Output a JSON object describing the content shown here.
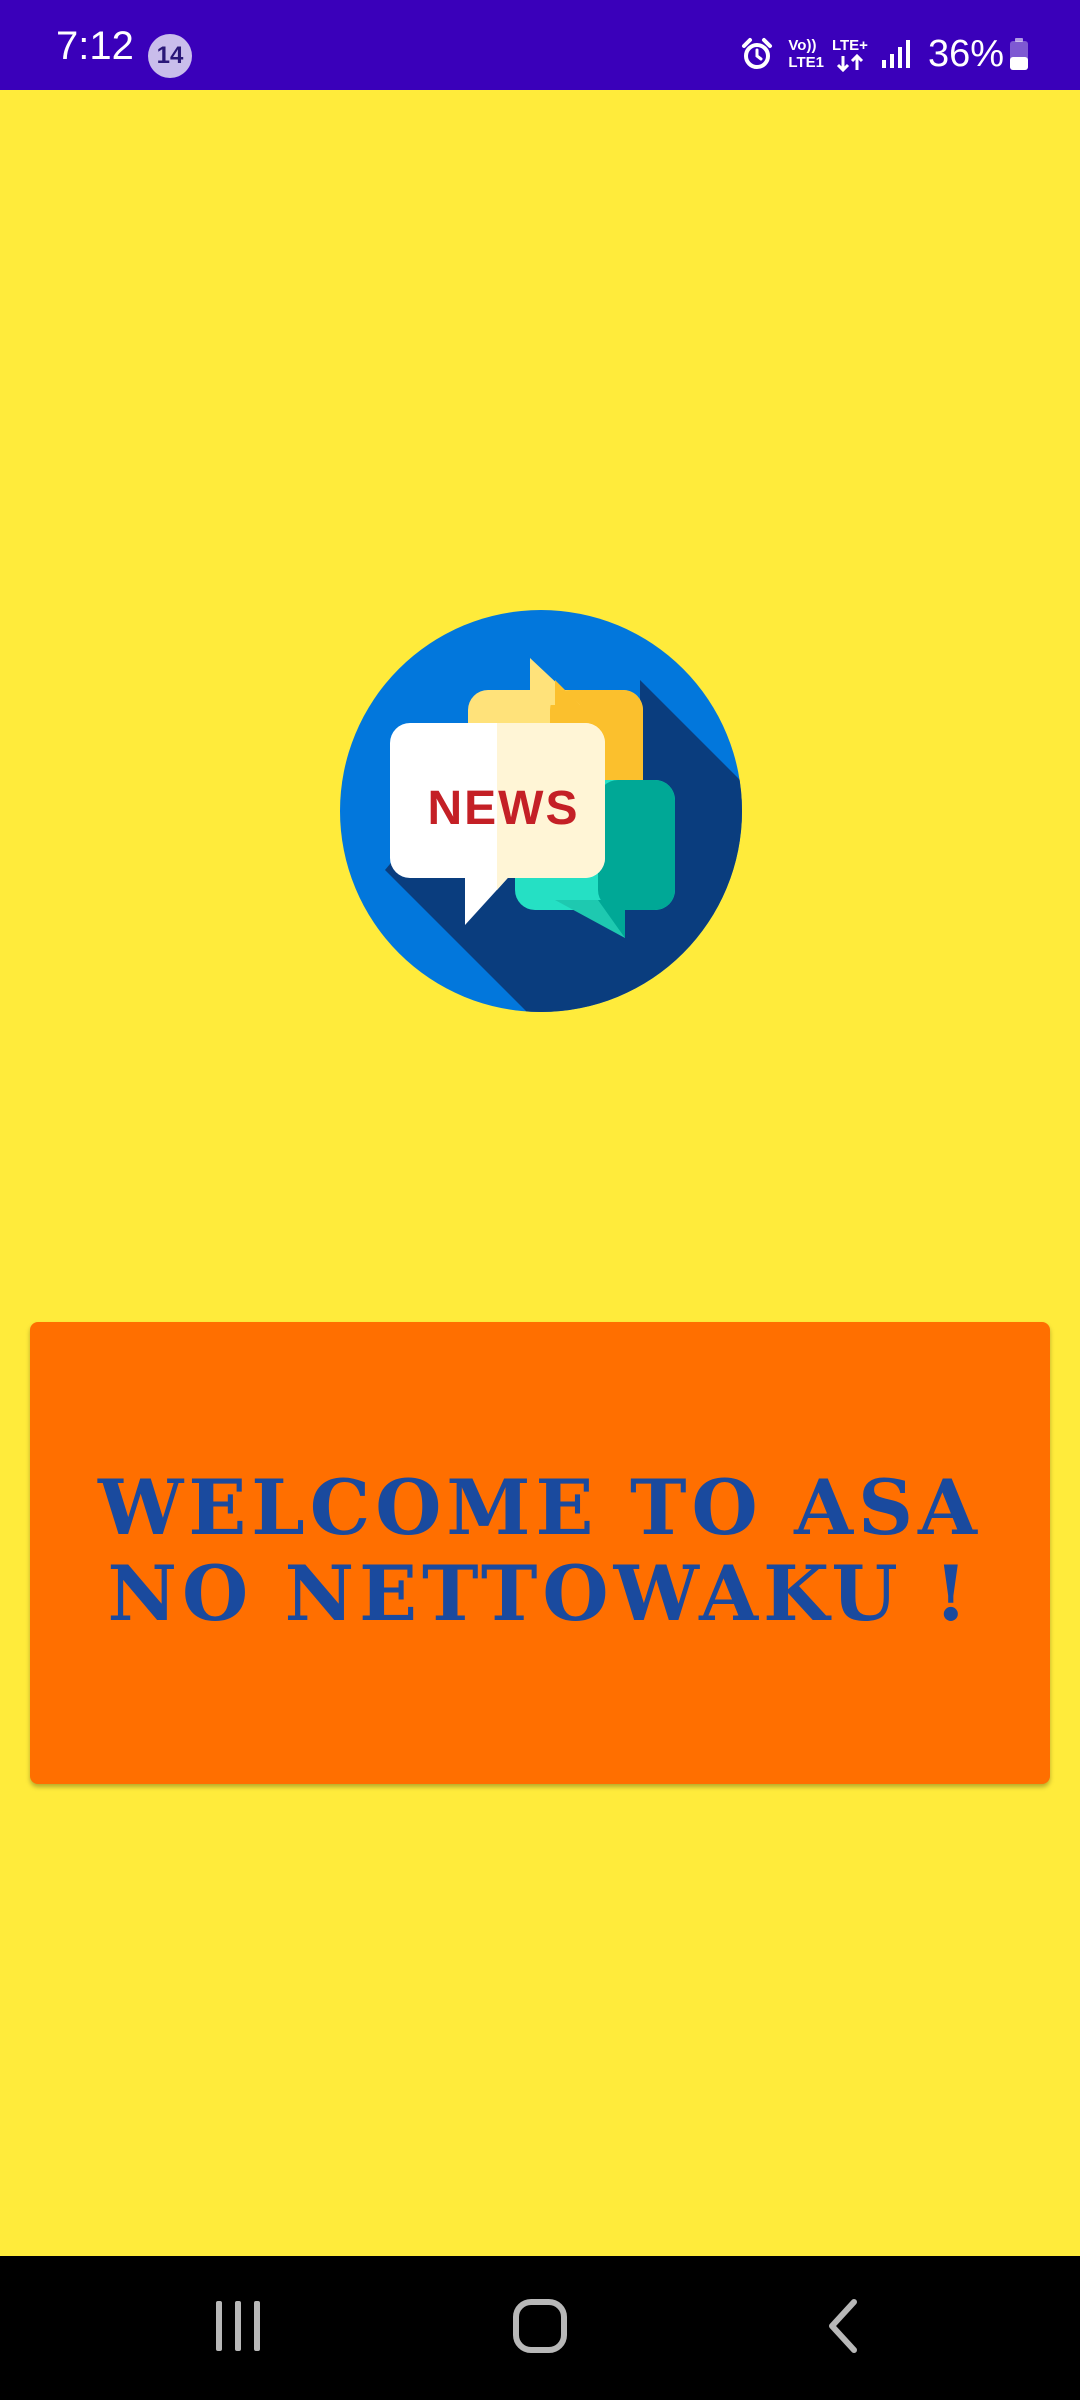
{
  "status_bar": {
    "time": "7:12",
    "notification_count": "14",
    "volte_line1": "Vo))",
    "volte_line2": "LTE1",
    "network_type": "LTE+",
    "battery_percent": "36%",
    "icons": [
      "alarm-icon",
      "data-arrows-icon",
      "signal-icon",
      "battery-icon"
    ]
  },
  "logo": {
    "text": "NEWS",
    "icon": "news-chat-bubbles-logo"
  },
  "welcome": {
    "text": "WELCOME TO ASA NO NETTOWAKU !"
  },
  "nav_bar": {
    "icons": [
      "recent-apps-icon",
      "home-icon",
      "back-icon"
    ]
  },
  "colors": {
    "background": "#FFEB3B",
    "status_bar": "#3A00BA",
    "card": "#FF6F00",
    "welcome_text": "#1A4A9E",
    "logo_circle": "#0277DC",
    "logo_text": "#C42026"
  }
}
